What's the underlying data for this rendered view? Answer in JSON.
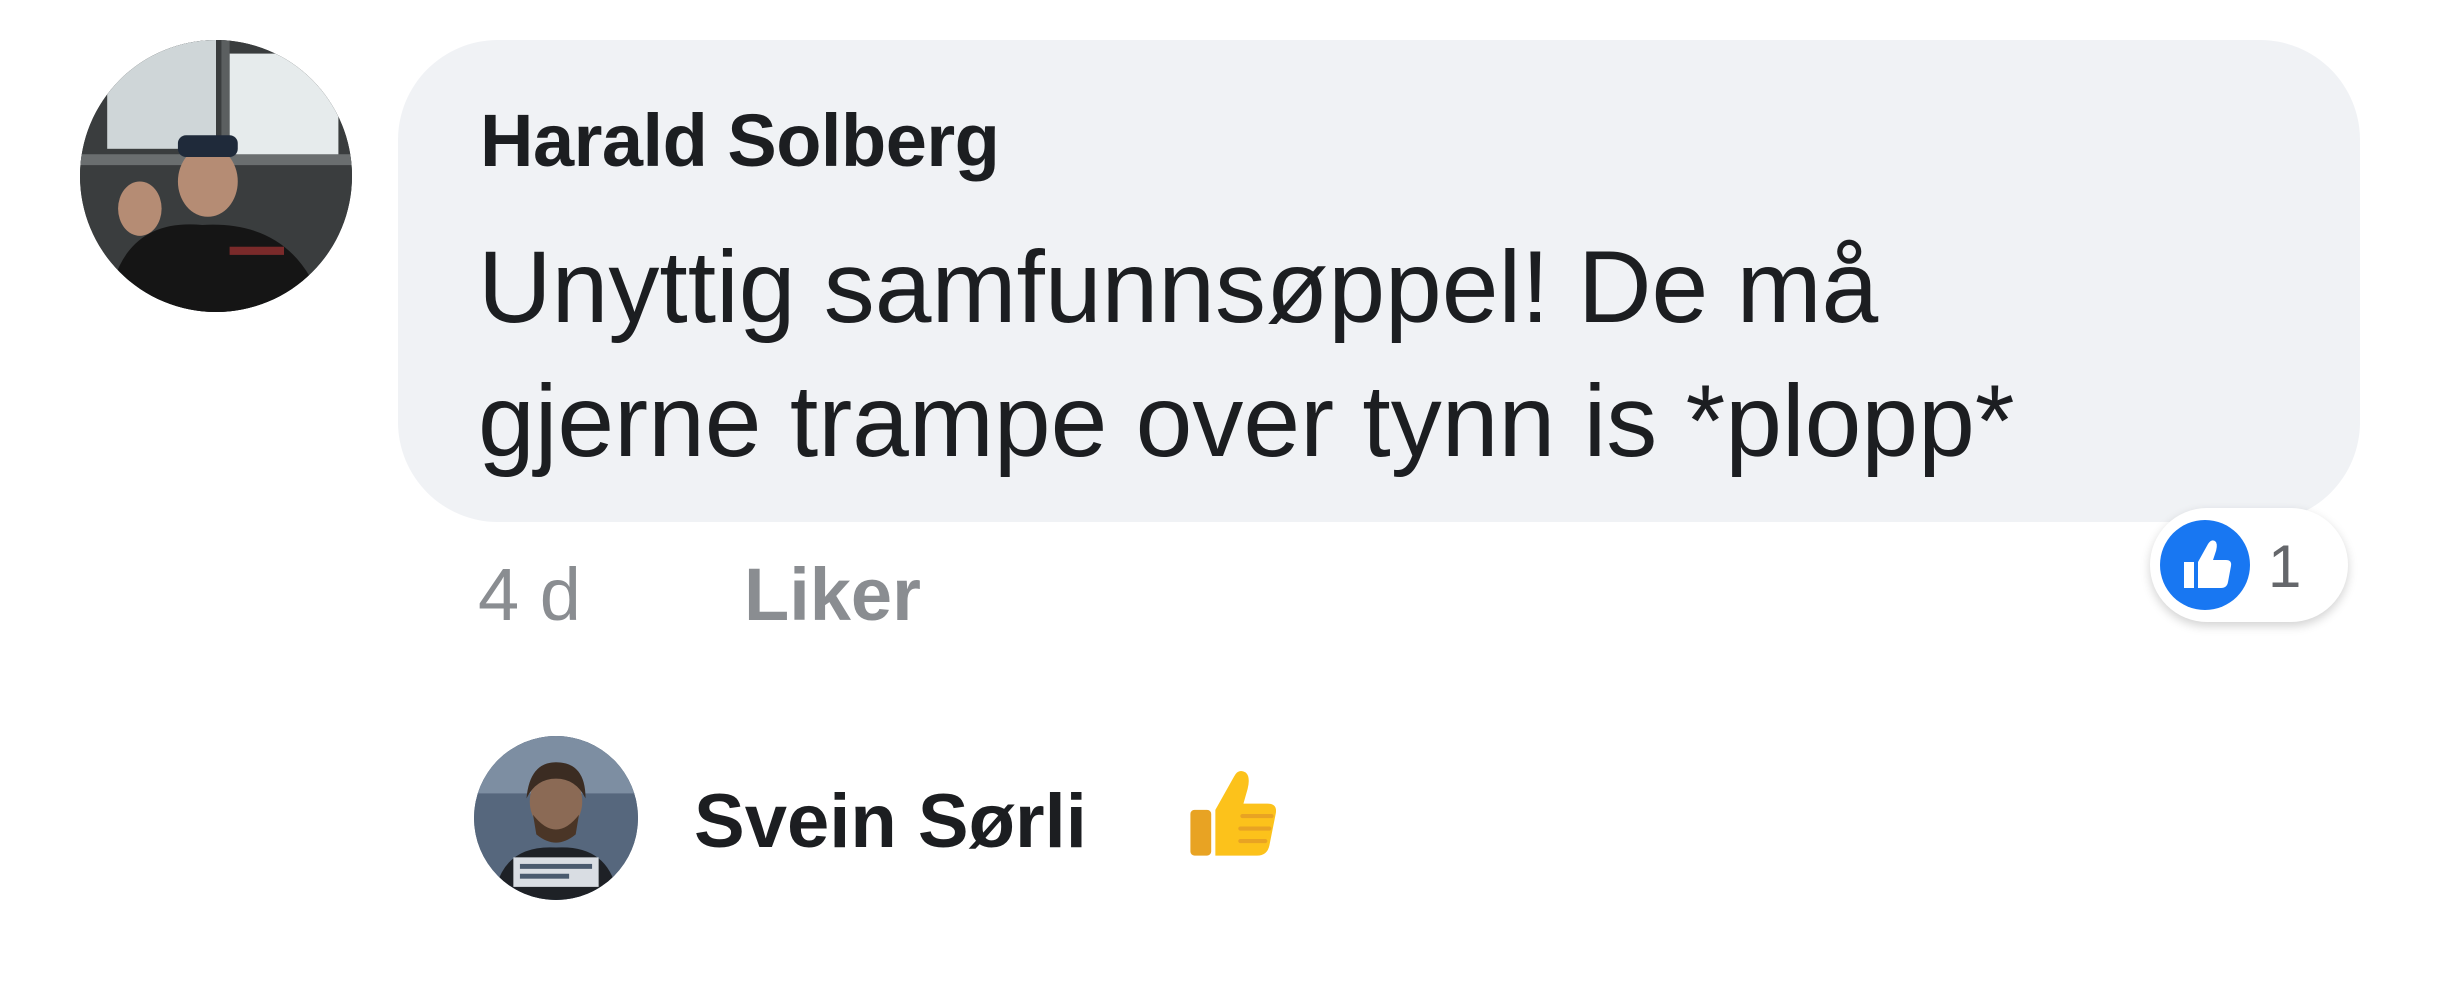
{
  "comment": {
    "author": "Harald Solberg",
    "text": "Unyttig samfunnsøppel! De må\ngjerne trampe over tynn is *plopp*",
    "time": "4 d",
    "like_label": "Liker",
    "reaction": {
      "icon": "like-icon",
      "count": "1",
      "color": "#1877f2"
    }
  },
  "reply": {
    "author": "Svein Sørli",
    "emoji": "thumbs-up-emoji"
  },
  "colors": {
    "bubble": "#f0f2f5",
    "name_text": "#1c1e21",
    "meta_text": "#8a8d91",
    "like_blue": "#1877f2"
  }
}
